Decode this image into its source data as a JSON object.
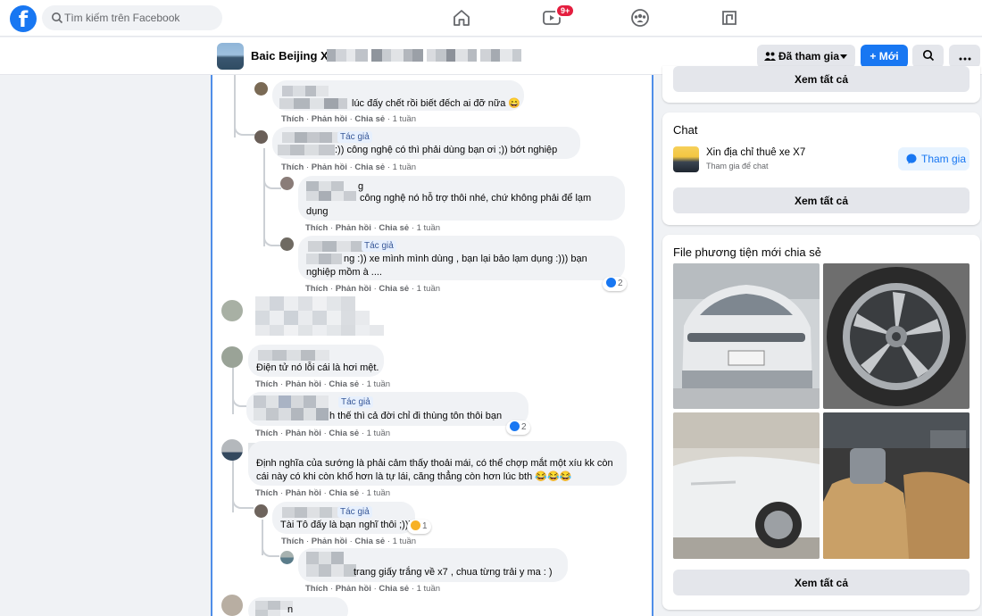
{
  "topnav": {
    "search_placeholder": "Tìm kiếm trên Facebook",
    "notification_count": "9+"
  },
  "group": {
    "name": "Baic Beijing X7",
    "joined_label": "Đã tham gia",
    "new_label": "+ Mới"
  },
  "comments": [
    {
      "text": "lúc đấy chết rồi biết đếch ai đỡ nữa 😄",
      "time": "1 tuần"
    },
    {
      "author_badge": "Tác giả",
      "text": ":)) công nghệ có thì phải dùng bạn ơi ;)) bớt nghiệp",
      "time": "1 tuần"
    },
    {
      "name_tail": "g",
      "text_line1": "công nghệ nó hỗ trợ thôi nhé, chứ không phải để lạm",
      "text_line2": "dụng",
      "time": "1 tuần"
    },
    {
      "author_badge": "Tác giả",
      "text_line1": "ng :)) xe mình mình dùng , bạn lại bảo lạm dụng :))) bạn",
      "text_line2": "nghiệp mồm à ....",
      "time": "1 tuần",
      "reactions": "2"
    },
    {
      "text": "Điện tử nó lỗi cái là hơi mệt.",
      "time": "1 tuần"
    },
    {
      "author_badge": "Tác giả",
      "text": "h thế thì cả đời chỉ đi thùng tôn thôi bạn",
      "time": "1 tuần",
      "reactions": "2"
    },
    {
      "text_line1": "Định nghĩa của sướng là phải cảm thấy thoải mái, có thể chợp mắt một xíu kk còn",
      "text_line2": "cái này có khi còn khổ hơn là tự lái, căng thẳng còn hơn lúc bth 😂😂😂",
      "time": "1 tuần"
    },
    {
      "author_badge": "Tác giả",
      "text": "Tài Tô đấy là bạn nghĩ thôi ;)))",
      "time": "1 tuần",
      "reactions": "1"
    },
    {
      "text": "trang giấy trắng về x7 , chua từng trải y ma : )",
      "time": "1 tuần"
    },
    {
      "name_tail": "n"
    }
  ],
  "actions": {
    "like": "Thích",
    "reply": "Phản hồi",
    "share": "Chia sẻ",
    "sep": "·"
  },
  "sidebar": {
    "see_all": "Xem tất cả",
    "chat": {
      "heading": "Chat",
      "title": "Xin địa chỉ thuê xe X7",
      "subtitle": "Tham gia để chat",
      "join_label": "Tham gia"
    },
    "media": {
      "heading": "File phương tiện mới chia sẻ"
    }
  },
  "colors": {
    "brand": "#1877f2",
    "badge": "#e41e3f",
    "highlight_border": "#4f8ee8"
  },
  "icons": [
    "facebook-logo-icon",
    "search-icon",
    "home-icon",
    "watch-icon",
    "groups-icon",
    "gaming-icon",
    "members-icon",
    "search-icon",
    "more-icon",
    "messenger-icon",
    "like-reaction-icon",
    "haha-reaction-icon"
  ]
}
